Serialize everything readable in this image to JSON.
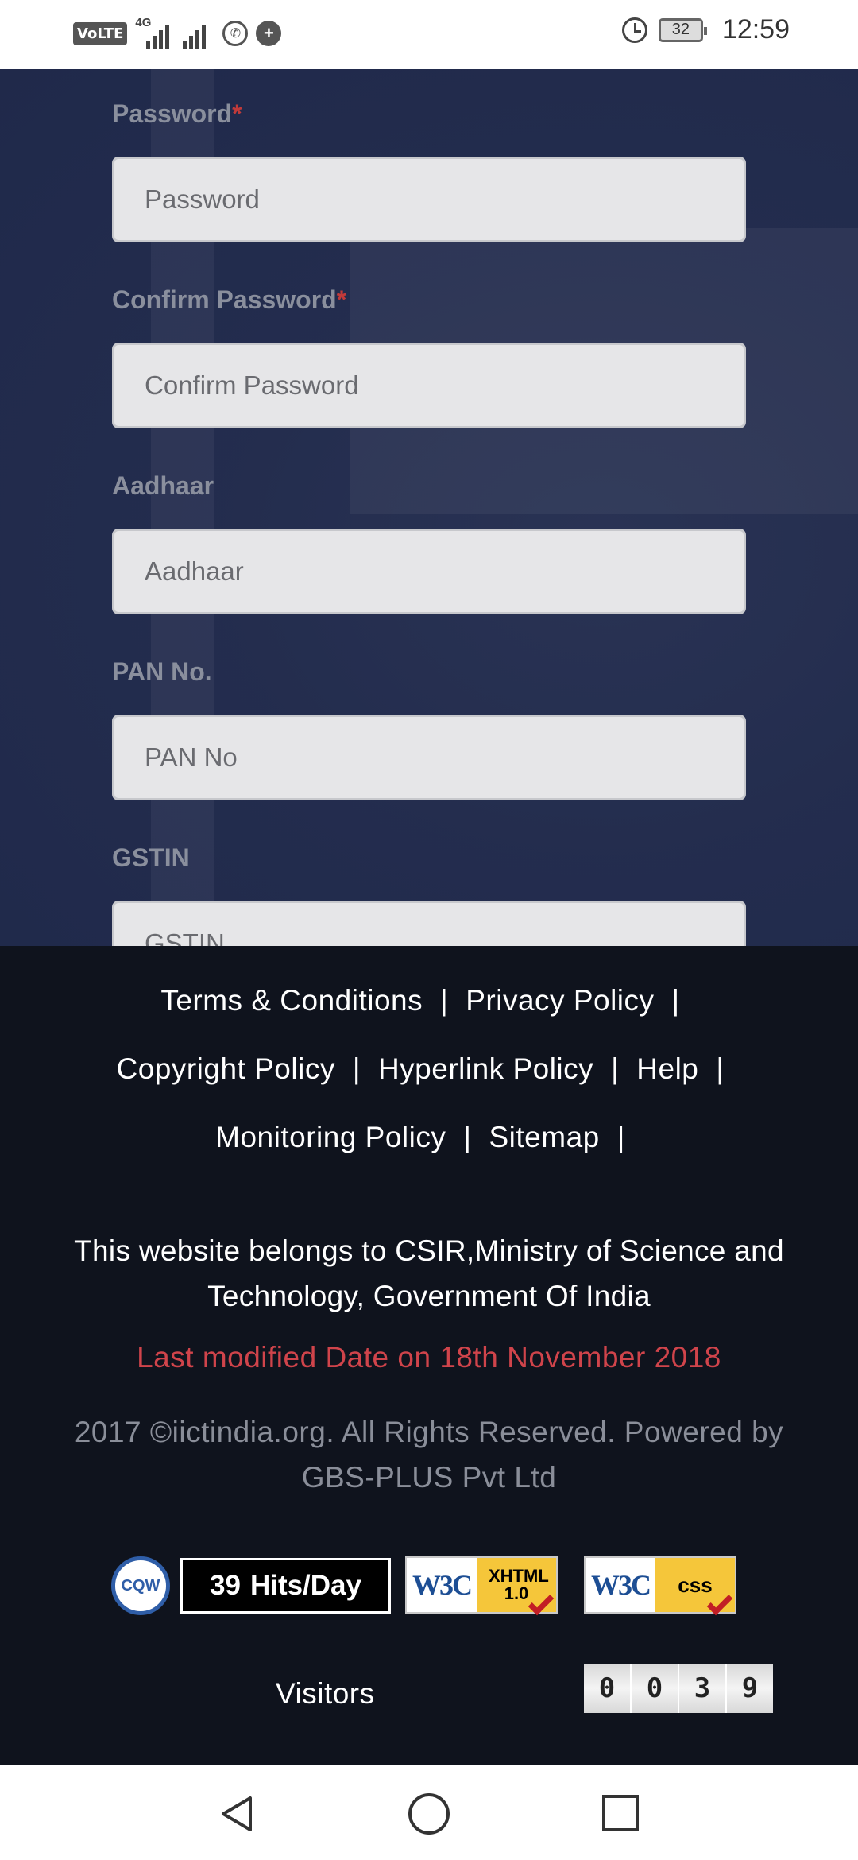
{
  "status_bar": {
    "volte": "VoLTE",
    "network": "4G",
    "battery": "32",
    "time": "12:59"
  },
  "form": {
    "password": {
      "label": "Password",
      "required": "*",
      "placeholder": "Password"
    },
    "confirm_password": {
      "label": "Confirm Password",
      "required": "*",
      "placeholder": "Confirm Password"
    },
    "aadhaar": {
      "label": "Aadhaar",
      "placeholder": "Aadhaar"
    },
    "pan": {
      "label": "PAN No.",
      "placeholder": "PAN No"
    },
    "gstin": {
      "label": "GSTIN",
      "placeholder": "GSTIN"
    }
  },
  "footer": {
    "links": {
      "terms": "Terms & Conditions",
      "privacy": "Privacy Policy",
      "copyright": "Copyright Policy",
      "hyperlink": "Hyperlink Policy",
      "help": "Help",
      "monitoring": "Monitoring Policy",
      "sitemap": "Sitemap",
      "separator": "|"
    },
    "about": "This website belongs to CSIR,Ministry of Science and Technology, Government Of India",
    "last_modified": "Last modified Date on 18th November 2018",
    "copyright_text": "2017 ©iictindia.org. All Rights Reserved. Powered by GBS-PLUS Pvt Ltd",
    "badges": {
      "cqw": "CQW",
      "hits_count": "39",
      "hits_unit": "Hits/Day",
      "w3c": "W3C",
      "xhtml": "XHTML 1.0",
      "css": "css"
    },
    "visitors_label": "Visitors",
    "visitor_digits": [
      "0",
      "0",
      "3",
      "9"
    ]
  },
  "colors": {
    "required": "#c13a3a",
    "last_modified": "#d0444b",
    "footer_bg": "#0f131d"
  }
}
